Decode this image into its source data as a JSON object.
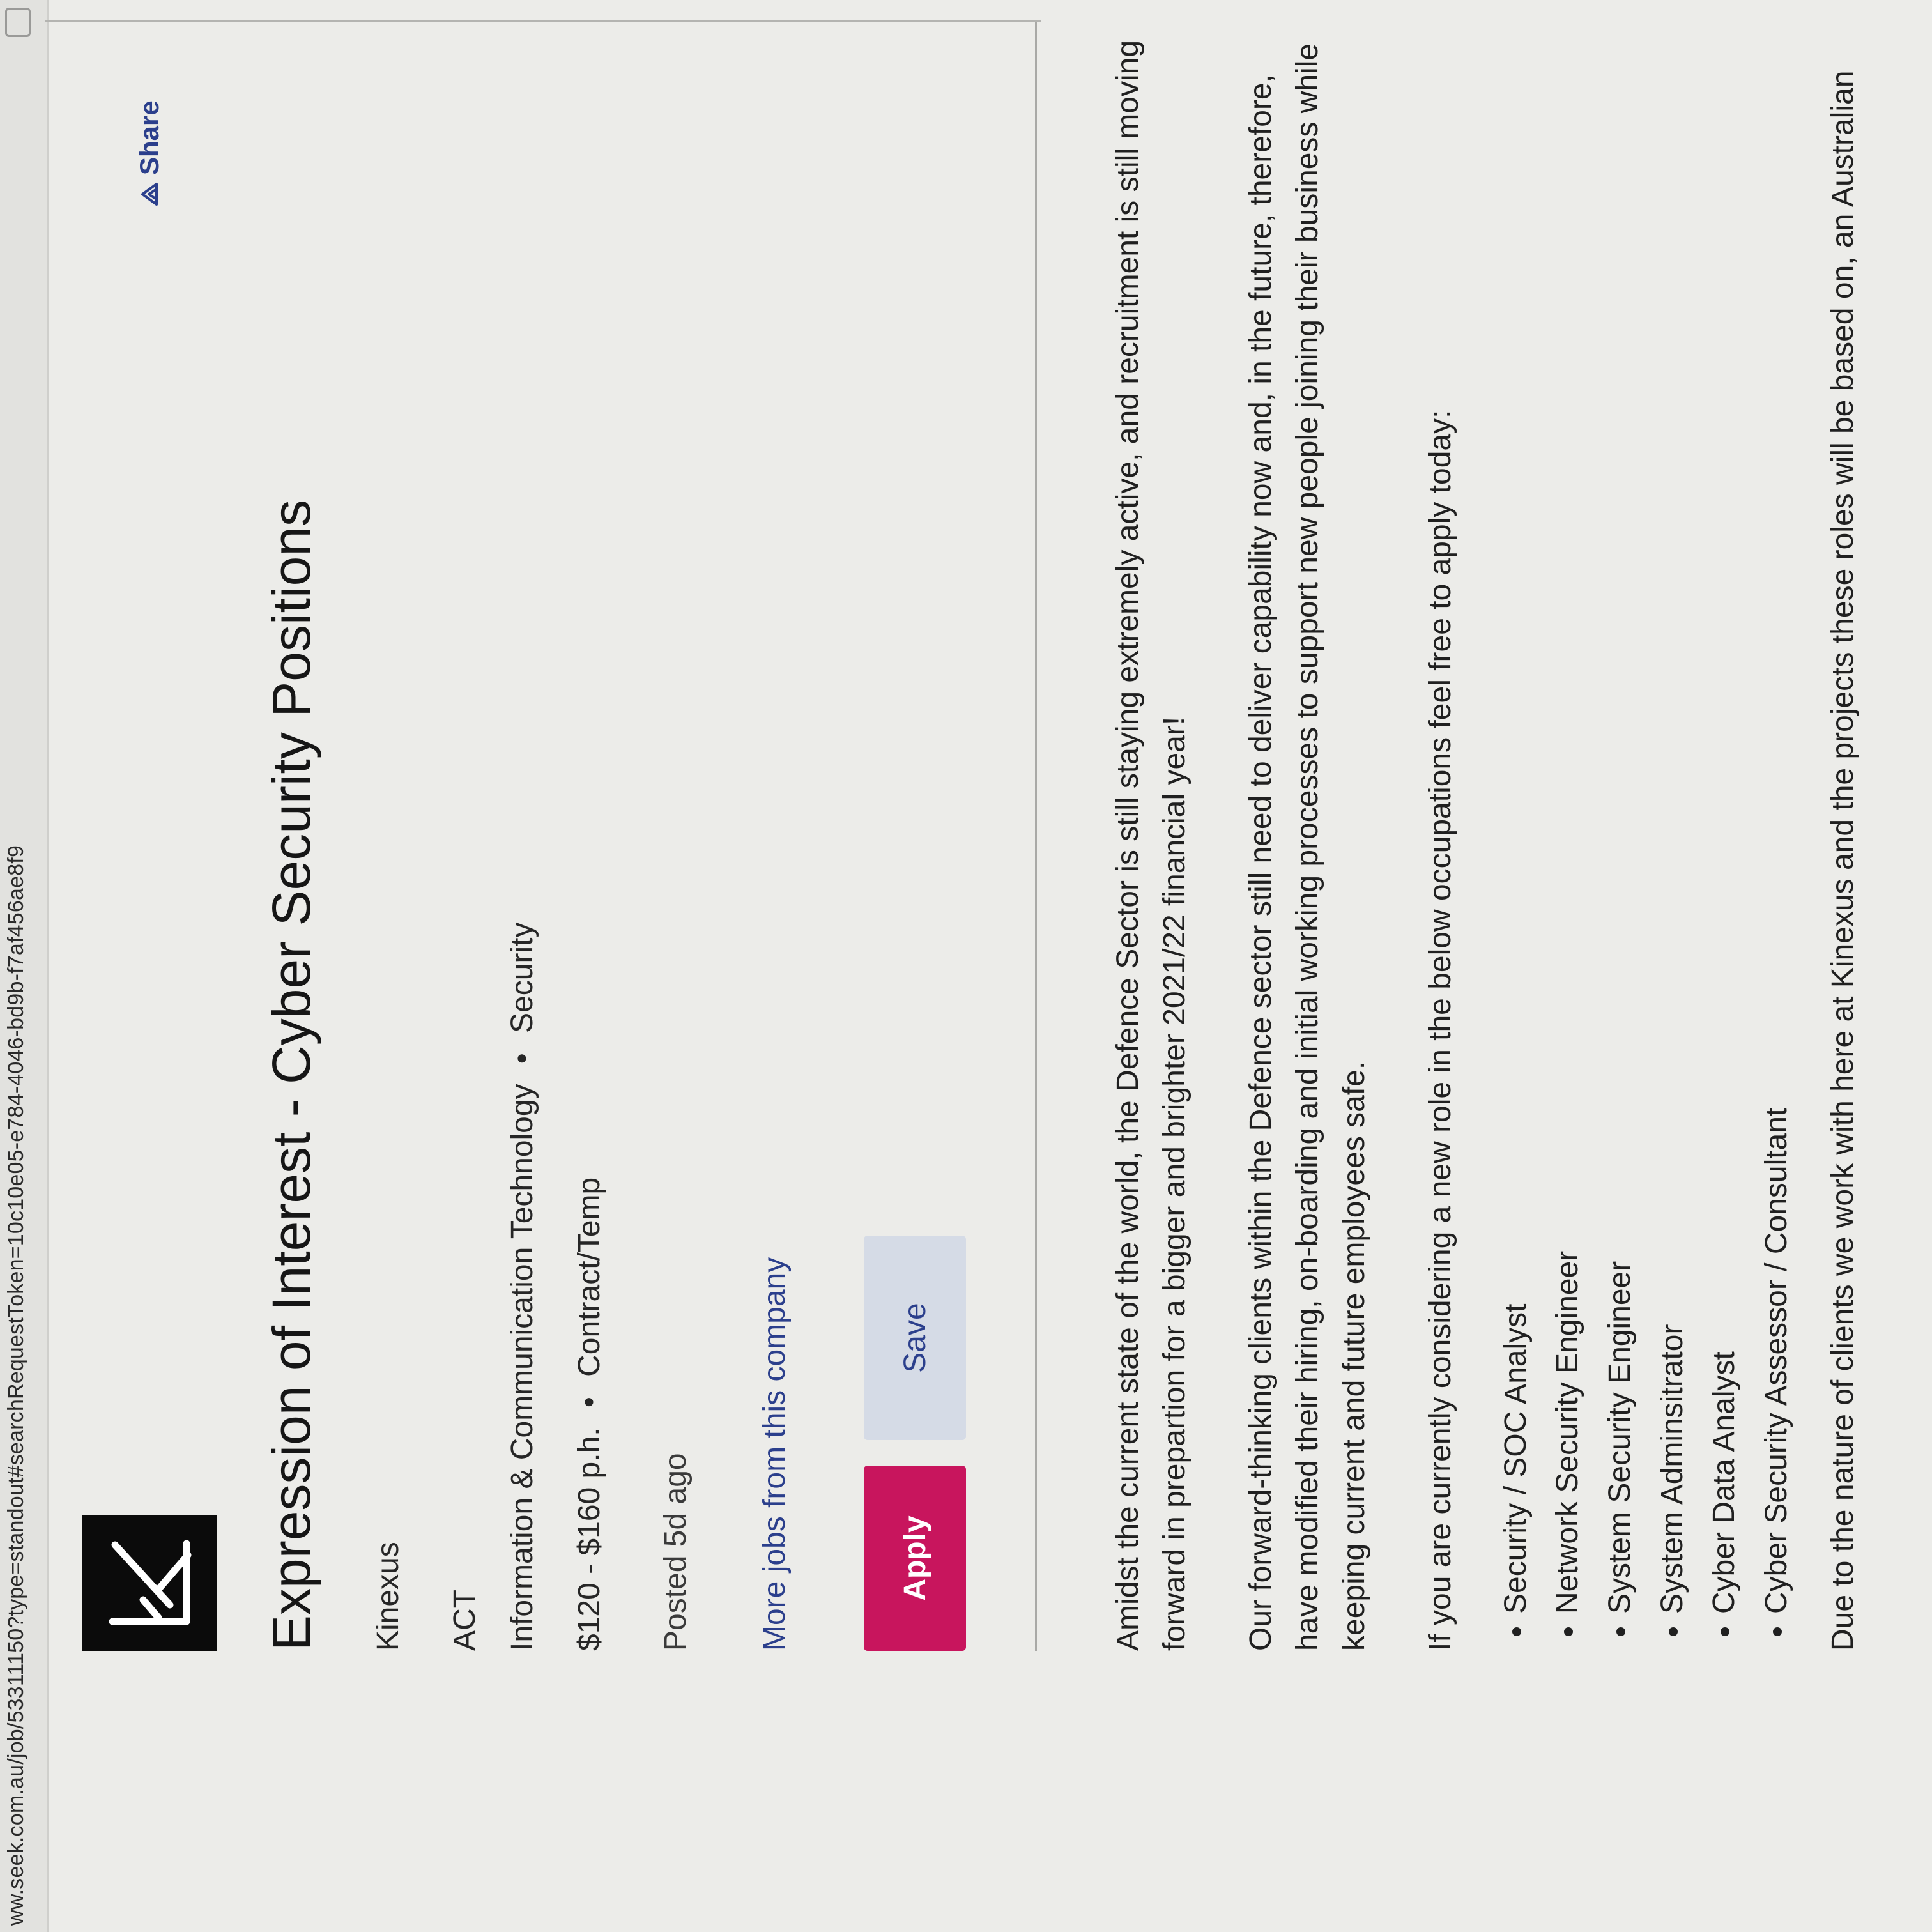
{
  "browser": {
    "url": "ww.seek.com.au/job/53311150?type=standout#searchRequestToken=10c10e05-e784-4046-bd9b-f7af456ae8f9"
  },
  "job": {
    "title": "Expression of Interest - Cyber Security Positions",
    "company": "Kinexus",
    "location": "ACT",
    "classification": "Information & Communication Technology",
    "subclassification": "Security",
    "pay": "$120 - $160 p.h.",
    "work_type": "Contract/Temp",
    "posted": "Posted 5d ago",
    "more_jobs_link": "More jobs from this company",
    "share_label": "Share",
    "separator": "•"
  },
  "actions": {
    "apply_label": "Apply",
    "save_label": "Save"
  },
  "description": {
    "paragraphs": [
      "Amidst the current state of the world, the Defence Sector is still staying extremely active, and recruitment is still moving forward in prepartion for a bigger and brighter 2021/22 financial year!",
      "Our forward-thinking clients within the Defence sector still need to deliver capability now and, in the future, therefore, have modified their hiring, on-boarding and initial working processes to support new people joining their business while keeping current and future employees safe.",
      "If you are currently considering a new role in the below occupations feel free to apply today:"
    ],
    "occupations": [
      "Security / SOC Analyst",
      "Network Security Engineer",
      "System Security Engineer",
      "System Adminsitrator",
      "Cyber Data Analyst",
      "Cyber Security Assessor / Consultant"
    ],
    "trailing_text": "Due to the nature of clients we work with here at Kinexus and the projects these roles will be based on, an Australian"
  },
  "colors": {
    "apply_bg": "#c8155d",
    "save_bg": "#d5dbe6",
    "link": "#2b3f8c",
    "logo_bg": "#0b0b0b"
  },
  "icons": {
    "logo": "kinexus-k-logo",
    "share": "share-icon",
    "tab": "tab-icon"
  }
}
